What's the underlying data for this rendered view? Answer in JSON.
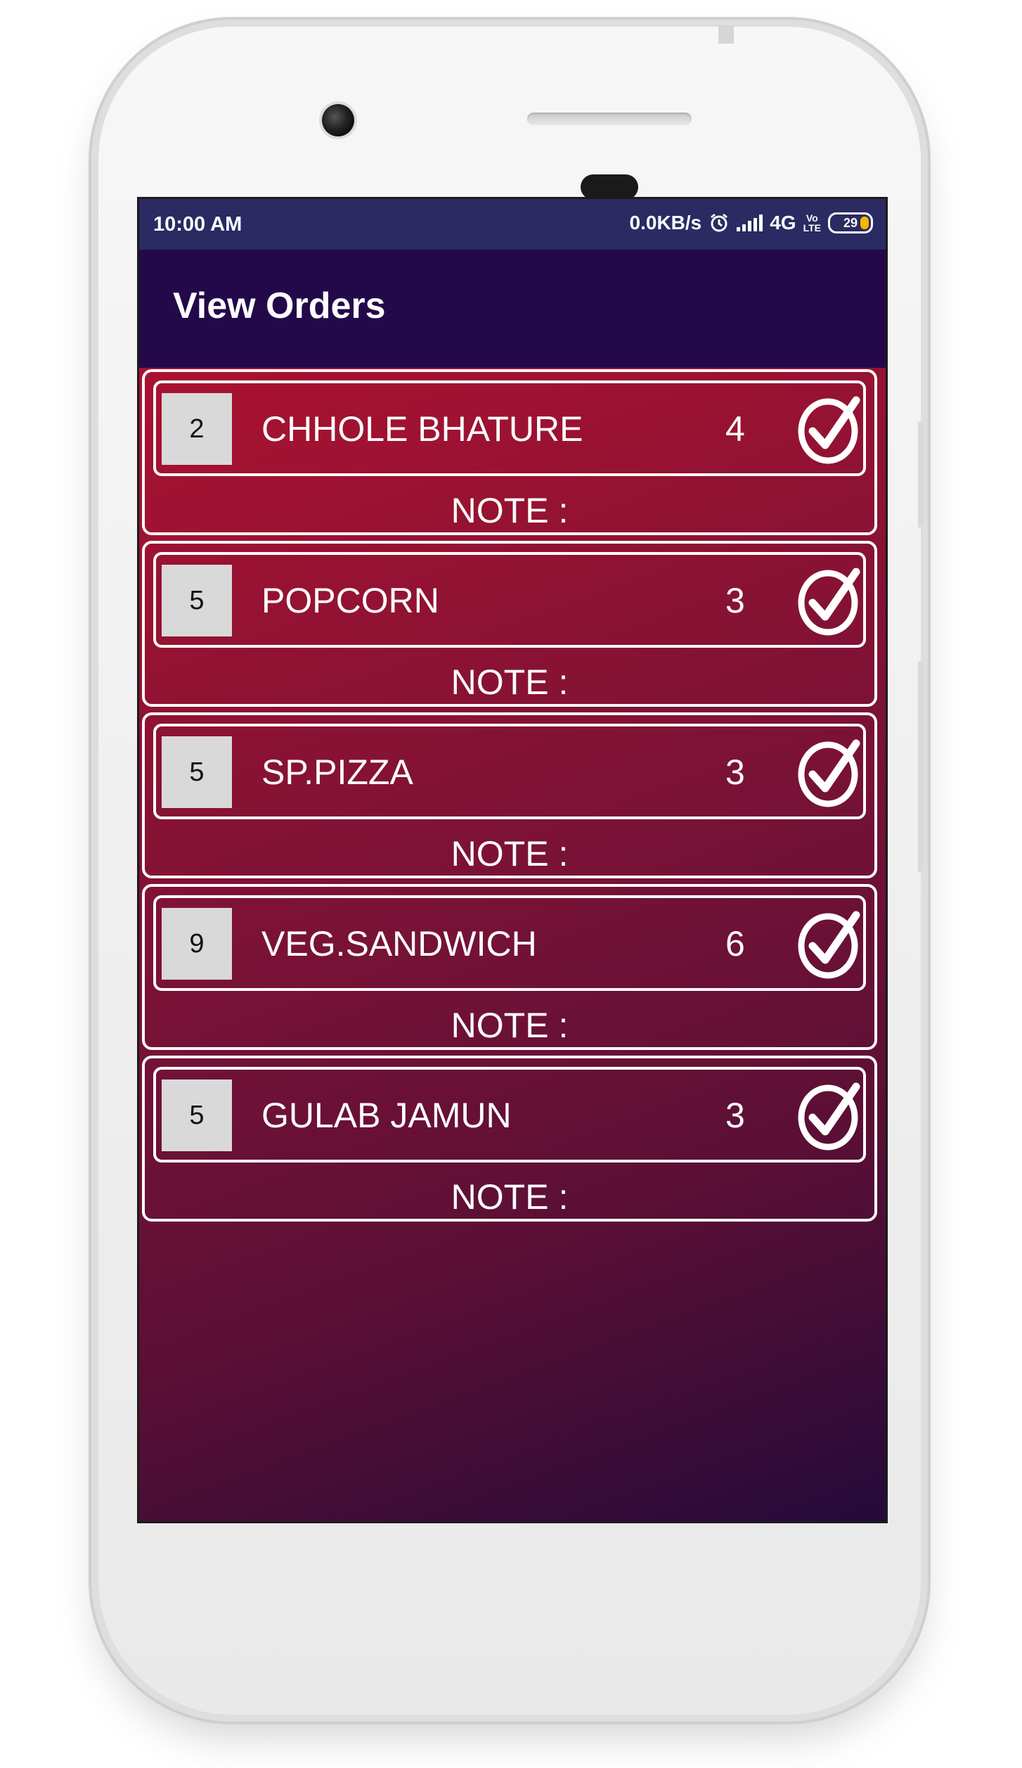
{
  "statusbar": {
    "time": "10:00 AM",
    "speed": "0.0KB/s",
    "network": "4G",
    "volte_top": "Vo",
    "volte_bottom": "LTE",
    "battery": "29"
  },
  "appbar": {
    "title": "View Orders"
  },
  "orders": [
    {
      "table": "2",
      "item": "CHHOLE BHATURE",
      "qty": "4",
      "note": "NOTE :"
    },
    {
      "table": "5",
      "item": "POPCORN",
      "qty": "3",
      "note": "NOTE :"
    },
    {
      "table": "5",
      "item": "SP.PIZZA",
      "qty": "3",
      "note": "NOTE :"
    },
    {
      "table": "9",
      "item": "VEG.SANDWICH",
      "qty": "6",
      "note": "NOTE :"
    },
    {
      "table": "5",
      "item": "GULAB JAMUN",
      "qty": "3",
      "note": "NOTE :"
    }
  ],
  "icons": {
    "check": "check-circle-icon",
    "alarm": "alarm-icon",
    "signal": "signal-icon",
    "battery": "battery-icon"
  },
  "colors": {
    "statusbar": "#2b2a62",
    "appbar": "#24094a",
    "gradient_start": "#b8102e",
    "gradient_end": "#250a3a"
  }
}
